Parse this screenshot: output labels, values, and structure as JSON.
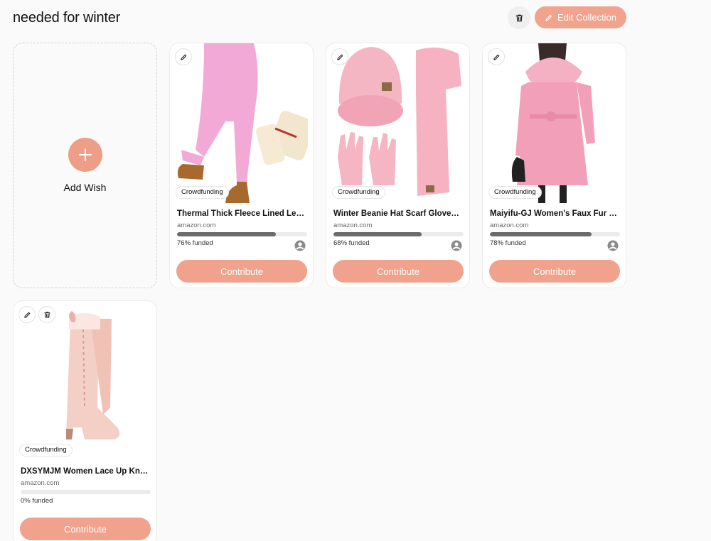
{
  "collection": {
    "title": "needed for winter",
    "edit_label": "Edit Collection"
  },
  "add_wish": {
    "label": "Add Wish"
  },
  "colors": {
    "accent": "#f0a28d",
    "progress": "#6b6b6b",
    "track": "#ececec"
  },
  "wishes": [
    {
      "name": "Thermal Thick Fleece Lined Leggings",
      "tag": "Crowdfunding",
      "domain": "amazon.com",
      "funded_text": "76% funded",
      "funded_fraction": 0.76,
      "contribute_label": "Contribute",
      "image_icon": "pink-leggings-image"
    },
    {
      "name": "Winter Beanie Hat Scarf Gloves, Set",
      "tag": "Crowdfunding",
      "domain": "amazon.com",
      "funded_text": "68% funded",
      "funded_fraction": 0.68,
      "contribute_label": "Contribute",
      "image_icon": "pink-hat-scarf-gloves-image"
    },
    {
      "name": "Maiyifu-GJ Women's Faux Fur Collar Coat",
      "tag": "Crowdfunding",
      "domain": "amazon.com",
      "funded_text": "78% funded",
      "funded_fraction": 0.78,
      "contribute_label": "Contribute",
      "image_icon": "pink-coat-image"
    },
    {
      "name": "DXSYMJM Women Lace Up Knee High Boots",
      "tag": "Crowdfunding",
      "domain": "amazon.com",
      "funded_text": "0% funded",
      "funded_fraction": 0.0,
      "contribute_label": "Contribute",
      "image_icon": "pink-boots-image"
    }
  ]
}
